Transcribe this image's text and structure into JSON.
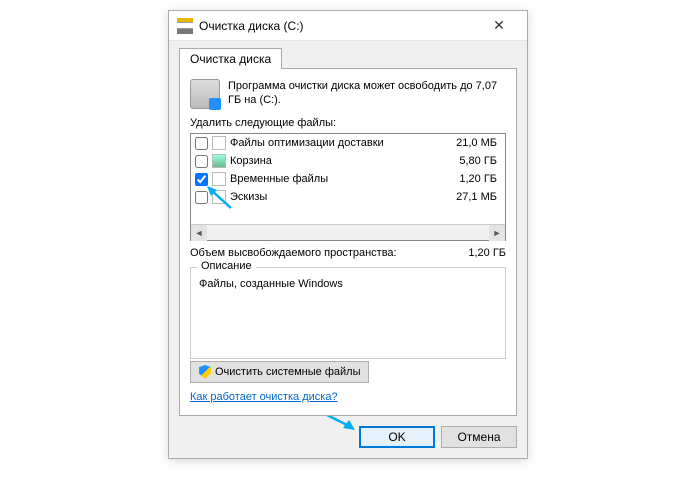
{
  "window": {
    "title": "Очистка диска (C:)"
  },
  "tabs": {
    "active": "Очистка диска"
  },
  "info_text": "Программа очистки диска может освободить до 7,07 ГБ на (C:).",
  "files_label": "Удалить следующие файлы:",
  "files": [
    {
      "name": "Файлы оптимизации доставки",
      "size": "21,0 МБ",
      "checked": false
    },
    {
      "name": "Корзина",
      "size": "5,80 ГБ",
      "checked": false
    },
    {
      "name": "Временные файлы",
      "size": "1,20 ГБ",
      "checked": true
    },
    {
      "name": "Эскизы",
      "size": "27,1 МБ",
      "checked": false
    }
  ],
  "summary": {
    "label": "Объем высвобождаемого пространства:",
    "value": "1,20 ГБ"
  },
  "description": {
    "heading": "Описание",
    "text": "Файлы, созданные Windows"
  },
  "sysfiles_btn": "Очистить системные файлы",
  "help_link": "Как работает очистка диска?",
  "buttons": {
    "ok": "OK",
    "cancel": "Отмена"
  }
}
